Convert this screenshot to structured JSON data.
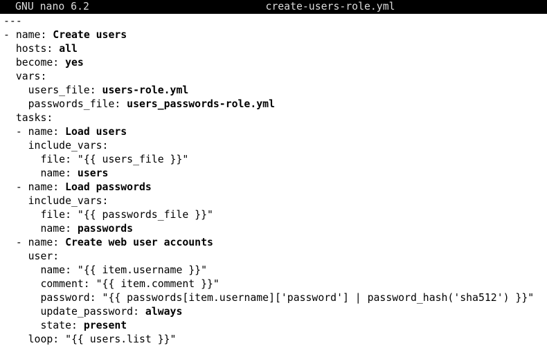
{
  "titlebar": {
    "app": "GNU nano 6.2",
    "filename": "create-users-role.yml"
  },
  "lines": [
    [
      {
        "t": "---",
        "c": "k"
      }
    ],
    [
      {
        "t": "- name: ",
        "c": "k"
      },
      {
        "t": "Create users",
        "c": "v"
      }
    ],
    [
      {
        "t": "  hosts: ",
        "c": "k"
      },
      {
        "t": "all",
        "c": "v"
      }
    ],
    [
      {
        "t": "  become: ",
        "c": "k"
      },
      {
        "t": "yes",
        "c": "v"
      }
    ],
    [
      {
        "t": "  vars:",
        "c": "k"
      }
    ],
    [
      {
        "t": "    users_file: ",
        "c": "k"
      },
      {
        "t": "users-role.yml",
        "c": "v"
      }
    ],
    [
      {
        "t": "    passwords_file: ",
        "c": "k"
      },
      {
        "t": "users_passwords-role.yml",
        "c": "v"
      }
    ],
    [
      {
        "t": "  tasks:",
        "c": "k"
      }
    ],
    [
      {
        "t": "  - name: ",
        "c": "k"
      },
      {
        "t": "Load users",
        "c": "v"
      }
    ],
    [
      {
        "t": "    include_vars:",
        "c": "k"
      }
    ],
    [
      {
        "t": "      file: ",
        "c": "k"
      },
      {
        "t": "\"{{ users_file }}\"",
        "c": "q"
      }
    ],
    [
      {
        "t": "      name: ",
        "c": "k"
      },
      {
        "t": "users",
        "c": "v"
      }
    ],
    [
      {
        "t": "  - name: ",
        "c": "k"
      },
      {
        "t": "Load passwords",
        "c": "v"
      }
    ],
    [
      {
        "t": "    include_vars:",
        "c": "k"
      }
    ],
    [
      {
        "t": "      file: ",
        "c": "k"
      },
      {
        "t": "\"{{ passwords_file }}\"",
        "c": "q"
      }
    ],
    [
      {
        "t": "      name: ",
        "c": "k"
      },
      {
        "t": "passwords",
        "c": "v"
      }
    ],
    [
      {
        "t": "  - name: ",
        "c": "k"
      },
      {
        "t": "Create web user accounts",
        "c": "v"
      }
    ],
    [
      {
        "t": "    user:",
        "c": "k"
      }
    ],
    [
      {
        "t": "      name: ",
        "c": "k"
      },
      {
        "t": "\"{{ item.username }}\"",
        "c": "q"
      }
    ],
    [
      {
        "t": "      comment: ",
        "c": "k"
      },
      {
        "t": "\"{{ item.comment }}\"",
        "c": "q"
      }
    ],
    [
      {
        "t": "      password: ",
        "c": "k"
      },
      {
        "t": "\"{{ passwords[item.username]['password'] | password_hash('sha512') }}\"",
        "c": "q"
      }
    ],
    [
      {
        "t": "      update_password: ",
        "c": "k"
      },
      {
        "t": "always",
        "c": "v"
      }
    ],
    [
      {
        "t": "      state: ",
        "c": "k"
      },
      {
        "t": "present",
        "c": "v"
      }
    ],
    [
      {
        "t": "    loop: ",
        "c": "k"
      },
      {
        "t": "\"{{ users.list }}\"",
        "c": "q"
      }
    ]
  ]
}
